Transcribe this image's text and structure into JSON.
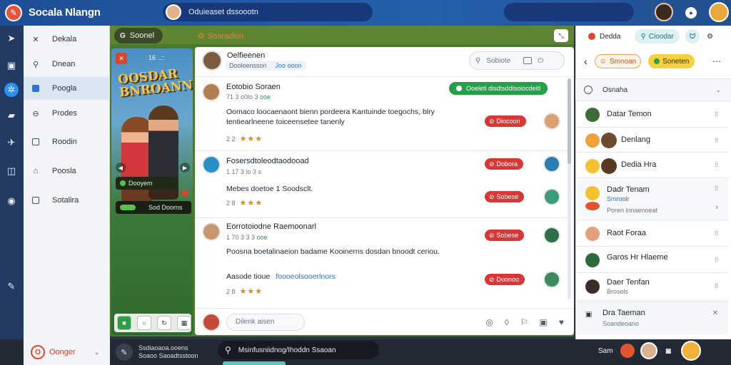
{
  "app": {
    "title": "Socala Nlangn"
  },
  "topbar": {
    "search_text": "Oduieaset dssoootn"
  },
  "nav": {
    "items": [
      {
        "label": "Dekala",
        "icon": "x-icon"
      },
      {
        "label": "Dnean",
        "icon": "search-icon"
      },
      {
        "label": "Poogla",
        "icon": "square-filled-icon"
      },
      {
        "label": "Prodes",
        "icon": "circle-icon"
      },
      {
        "label": "Roodin",
        "icon": "square-icon"
      },
      {
        "label": "Poosla",
        "icon": "shield-icon"
      },
      {
        "label": "Sotalira",
        "icon": "square-icon"
      }
    ],
    "footer_label": "Oonger"
  },
  "game": {
    "search_label": "Soonel",
    "label": "Soaradlon",
    "poster_title": "OOSDAR BNROANN",
    "poster_meta": "16 ..::",
    "pill1": "Dooyem",
    "pill2": "Sod Doorns"
  },
  "feed": {
    "header": {
      "name": "Oelfieenen",
      "sub1": "Dooloensson",
      "sub2": "Joo ooon",
      "search_placeholder": "Sobiote"
    },
    "green_pill": "Ooeleti disdtsddlsoiocdeitl",
    "posts": [
      {
        "name": "Eotobio Soraen",
        "meta": "71 3 o0lo 3 ",
        "meta_tag": "ooe",
        "text": "Oomaco loocaenaont bienn pordeera Kantuinde toegochs, blry tentiearlneene toiceensetee tanenly",
        "stats": "2 2",
        "badge": "Diocoon",
        "rating_stars": "★★★"
      },
      {
        "name": "Fosersdtoleodtaodooad",
        "meta": "1 17 3 lo 3 s ",
        "meta_tag": "",
        "text": "Mebes doetoe 1 Soodsclt.",
        "stats": "2 8",
        "badge": "Dobora",
        "badge2": "Sobese",
        "rating_stars": "★★★"
      },
      {
        "name": "Eorrotoiodne Raemoonarl",
        "meta": "1 70 3 3 3 ",
        "meta_tag": "ooe",
        "text": "Poosna boetalinaeion badame Kooinerns dosdan bnoodt ceriou.",
        "link_prefix": "Aasode tioue",
        "link": "foooeolsooerlnors",
        "stats": "2 8",
        "badge": "Sobese",
        "badge2": "Doonoo",
        "rating_stars": "★★★"
      }
    ],
    "composer_placeholder": "Dilenk aisen"
  },
  "right": {
    "tabs": [
      "Dedda",
      "Cioodar"
    ],
    "pill1": "Smnoan",
    "pill2": "Soneten",
    "section": "Osnaha",
    "rows": [
      {
        "name": "Datar Temon",
        "sub": ""
      },
      {
        "name": "Denlang",
        "sub": ""
      },
      {
        "name": "Dedia Hra",
        "sub": ""
      },
      {
        "name": "Dadr Tenam",
        "sub": "Smroolr",
        "sub2": "Poren lnnaenoeat"
      },
      {
        "name": "Raot Foraa",
        "sub": ""
      },
      {
        "name": "Garos Hr Hlaeme",
        "sub": ""
      },
      {
        "name": "Daer Tenfan",
        "sub": "Brosels"
      }
    ],
    "bottom": {
      "name": "Dra Taeman",
      "sub": "Soandeoano"
    }
  },
  "bottom": {
    "user_line1": "Ssdiaoaoa.ooens",
    "user_line2": "Soaoo Saoadtsstoon",
    "search_text": "Msinfusniidnog/Ihoddn Ssaoan",
    "right_label": "Sam"
  },
  "colors": {
    "accent": "#2460ab",
    "badge_red": "#d93636",
    "green": "#23a148",
    "star": "#e08a18"
  }
}
